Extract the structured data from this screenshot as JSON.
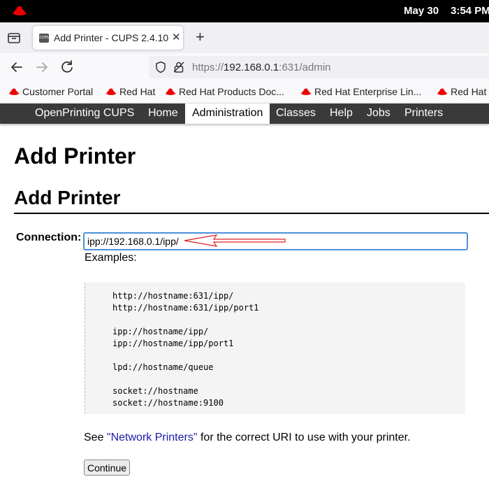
{
  "system_bar": {
    "date": "May 30",
    "time": "3:54 PM"
  },
  "browser": {
    "tab": {
      "title": "Add Printer - CUPS 2.4.10",
      "favicon_text": "CUPS"
    },
    "url": {
      "scheme": "https://",
      "host": "192.168.0.1",
      "rest": ":631/admin"
    },
    "bookmarks": [
      {
        "label": "Customer Portal"
      },
      {
        "label": "Red Hat"
      },
      {
        "label": "Red Hat Products Doc..."
      },
      {
        "label": "Red Hat Enterprise Lin..."
      },
      {
        "label": "Red Hat"
      }
    ]
  },
  "cups_nav": {
    "items": [
      {
        "label": "OpenPrinting CUPS"
      },
      {
        "label": "Home"
      },
      {
        "label": "Administration",
        "active": true
      },
      {
        "label": "Classes"
      },
      {
        "label": "Help"
      },
      {
        "label": "Jobs"
      },
      {
        "label": "Printers"
      }
    ]
  },
  "page": {
    "title": "Add Printer",
    "subtitle": "Add Printer",
    "connection_label": "Connection:",
    "connection_value": "ipp://192.168.0.1/ipp/",
    "examples_label": "Examples:",
    "examples": "http://hostname:631/ipp/\nhttp://hostname:631/ipp/port1\n\nipp://hostname/ipp/\nipp://hostname/ipp/port1\n\nlpd://hostname/queue\n\nsocket://hostname\nsocket://hostname:9100",
    "see_prefix": "See ",
    "see_link": "\"Network Printers\"",
    "see_suffix": " for the correct URI to use with your printer.",
    "continue_label": "Continue"
  },
  "colors": {
    "accent": "#4a90d9",
    "annotation_arrow": "#e02020",
    "link": "#1a1aa6",
    "cups_nav_bg": "#3a3a3a"
  }
}
